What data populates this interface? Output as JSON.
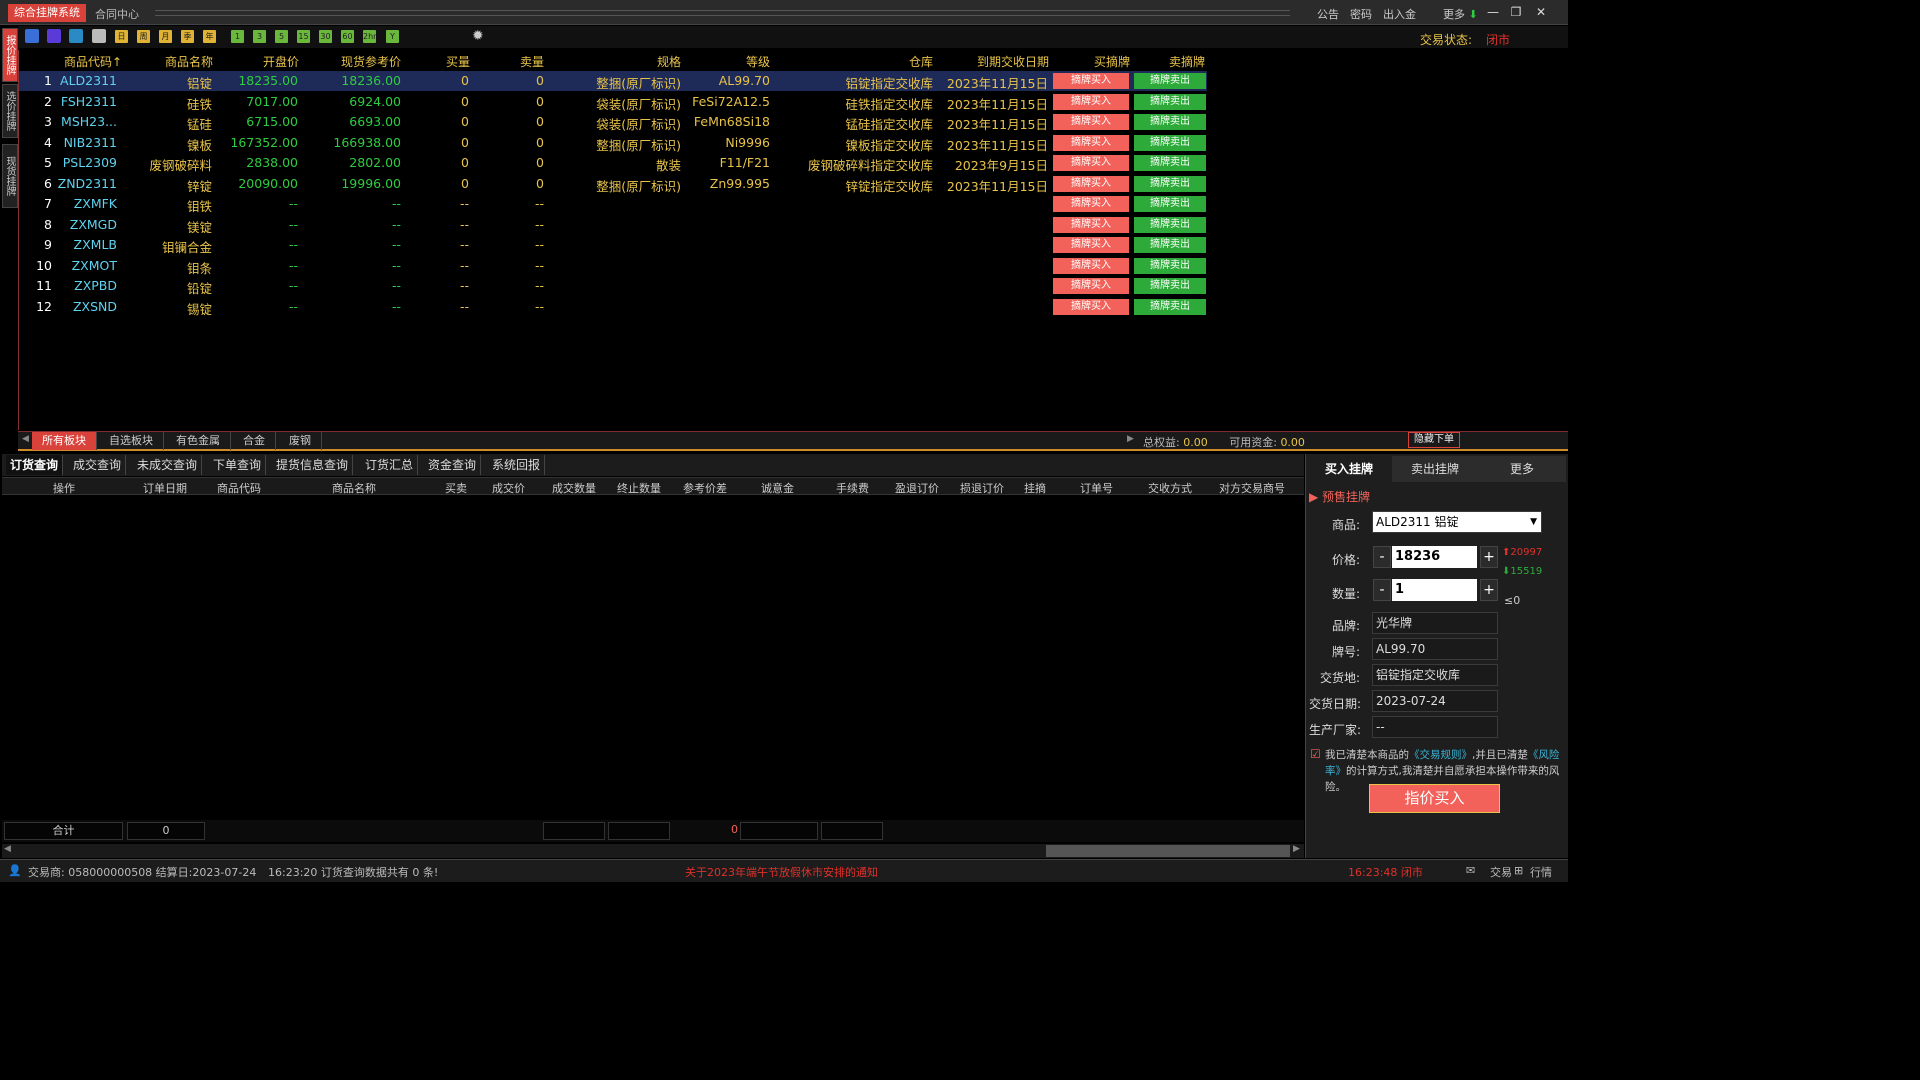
{
  "title_bar": {
    "app_title": "综合挂牌系统",
    "contract_center": "合同中心",
    "menus": [
      "公告",
      "密码",
      "出入金",
      "更多"
    ],
    "window_buttons": [
      "minimize",
      "restore",
      "close"
    ]
  },
  "toolbar": {
    "period_labels": [
      "日",
      "周",
      "月",
      "季",
      "年"
    ],
    "minute_labels": [
      "1",
      "3",
      "5",
      "15",
      "30",
      "60",
      "2hr",
      "Y"
    ],
    "trade_status_label": "交易状态:",
    "trade_status_value": "闭市"
  },
  "left_tabs": [
    "报价挂牌",
    "选价挂牌",
    "现货挂牌"
  ],
  "market": {
    "headers": [
      "商品代码↑",
      "商品名称",
      "开盘价",
      "现货参考价",
      "买量",
      "卖量",
      "规格",
      "等级",
      "仓库",
      "到期交收日期",
      "买摘牌",
      "卖摘牌"
    ],
    "buy_button_label": "摘牌买入",
    "sell_button_label": "摘牌卖出",
    "rows": [
      {
        "no": "1",
        "code": "ALD2311",
        "name": "铝锭",
        "open": "18235.00",
        "ref": "18236.00",
        "buy": "0",
        "sell": "0",
        "spec": "整捆(原厂标识)",
        "grade": "AL99.70",
        "warehouse": "铝锭指定交收库",
        "date": "2023年11月15日"
      },
      {
        "no": "2",
        "code": "FSH2311",
        "name": "硅铁",
        "open": "7017.00",
        "ref": "6924.00",
        "buy": "0",
        "sell": "0",
        "spec": "袋装(原厂标识)",
        "grade": "FeSi72A12.5",
        "warehouse": "硅铁指定交收库",
        "date": "2023年11月15日"
      },
      {
        "no": "3",
        "code": "MSH23...",
        "name": "锰硅",
        "open": "6715.00",
        "ref": "6693.00",
        "buy": "0",
        "sell": "0",
        "spec": "袋装(原厂标识)",
        "grade": "FeMn68Si18",
        "warehouse": "锰硅指定交收库",
        "date": "2023年11月15日"
      },
      {
        "no": "4",
        "code": "NIB2311",
        "name": "镍板",
        "open": "167352.00",
        "ref": "166938.00",
        "buy": "0",
        "sell": "0",
        "spec": "整捆(原厂标识)",
        "grade": "Ni9996",
        "warehouse": "镍板指定交收库",
        "date": "2023年11月15日"
      },
      {
        "no": "5",
        "code": "PSL2309",
        "name": "废钢破碎料",
        "open": "2838.00",
        "ref": "2802.00",
        "buy": "0",
        "sell": "0",
        "spec": "散装",
        "grade": "F11/F21",
        "warehouse": "废钢破碎料指定交收库",
        "date": "2023年9月15日"
      },
      {
        "no": "6",
        "code": "ZND2311",
        "name": "锌锭",
        "open": "20090.00",
        "ref": "19996.00",
        "buy": "0",
        "sell": "0",
        "spec": "整捆(原厂标识)",
        "grade": "Zn99.995",
        "warehouse": "锌锭指定交收库",
        "date": "2023年11月15日"
      },
      {
        "no": "7",
        "code": "ZXMFK",
        "name": "钼铁",
        "open": "--",
        "ref": "--",
        "buy": "--",
        "sell": "--",
        "spec": "",
        "grade": "",
        "warehouse": "",
        "date": ""
      },
      {
        "no": "8",
        "code": "ZXMGD",
        "name": "镁锭",
        "open": "--",
        "ref": "--",
        "buy": "--",
        "sell": "--",
        "spec": "",
        "grade": "",
        "warehouse": "",
        "date": ""
      },
      {
        "no": "9",
        "code": "ZXMLB",
        "name": "钼镧合金",
        "open": "--",
        "ref": "--",
        "buy": "--",
        "sell": "--",
        "spec": "",
        "grade": "",
        "warehouse": "",
        "date": ""
      },
      {
        "no": "10",
        "code": "ZXMOT",
        "name": "钼条",
        "open": "--",
        "ref": "--",
        "buy": "--",
        "sell": "--",
        "spec": "",
        "grade": "",
        "warehouse": "",
        "date": ""
      },
      {
        "no": "11",
        "code": "ZXPBD",
        "name": "铅锭",
        "open": "--",
        "ref": "--",
        "buy": "--",
        "sell": "--",
        "spec": "",
        "grade": "",
        "warehouse": "",
        "date": ""
      },
      {
        "no": "12",
        "code": "ZXSND",
        "name": "锡锭",
        "open": "--",
        "ref": "--",
        "buy": "--",
        "sell": "--",
        "spec": "",
        "grade": "",
        "warehouse": "",
        "date": ""
      }
    ]
  },
  "sector_tabs": [
    "所有板块",
    "自选板块",
    "有色金属",
    "合金",
    "废钢"
  ],
  "account": {
    "equity_label": "总权益:",
    "equity_value": "0.00",
    "available_label": "可用资金:",
    "available_value": "0.00",
    "hide_order": "隐藏下单"
  },
  "query": {
    "tabs": [
      "订货查询",
      "成交查询",
      "未成交查询",
      "下单查询",
      "提货信息查询",
      "订货汇总",
      "资金查询",
      "系统回报"
    ],
    "headers": [
      "操作",
      "订单日期",
      "商品代码",
      "商品名称",
      "买卖",
      "成交价",
      "成交数量",
      "终止数量",
      "参考价差",
      "诚意金",
      "手续费",
      "盈退订价",
      "损退订价",
      "挂摘",
      "订单号",
      "交收方式",
      "对方交易商号"
    ],
    "total_label": "合计",
    "total_count": "0",
    "total_amount": "0"
  },
  "order_panel": {
    "tabs": [
      "买入挂牌",
      "卖出挂牌",
      "更多"
    ],
    "presale_label": "预售挂牌",
    "product_label": "商品:",
    "product_value": "ALD2311 铝锭",
    "price_label": "价格:",
    "price_value": "18236",
    "price_upper": "20997",
    "price_lower": "15519",
    "qty_label": "数量:",
    "qty_value": "1",
    "qty_max": "≤0",
    "brand_label": "品牌:",
    "brand_value": "光华牌",
    "grade_label": "牌号:",
    "grade_value": "AL99.70",
    "place_label": "交货地:",
    "place_value": "铝锭指定交收库",
    "date_label": "交货日期:",
    "date_value": "2023-07-24",
    "maker_label": "生产厂家:",
    "maker_value": "--",
    "agree_1": "我已清楚本商品的",
    "agree_link1": "《交易规则》",
    "agree_2": ",并且已清楚",
    "agree_link2": "《风险率》",
    "agree_3": "的计算方式,我清楚并自愿承担本操作带来的风险。",
    "submit": "指价买入"
  },
  "status_bar": {
    "trader": "交易商: 058000000508 结算日:2023-07-24",
    "message": "16:23:20 订货查询数据共有 0 条!",
    "notice": "关于2023年端午节放假休市安排的通知",
    "time_status": "16:23:48 闭市",
    "right_items": [
      "交易",
      "行情"
    ]
  },
  "colors": {
    "accent": "#d9423a",
    "header_yellow": "#e8c34a",
    "price_green": "#2ecc40",
    "code_cyan": "#5fd3f0",
    "buy_red": "#f2625a",
    "sell_green": "#2eaa3a"
  }
}
